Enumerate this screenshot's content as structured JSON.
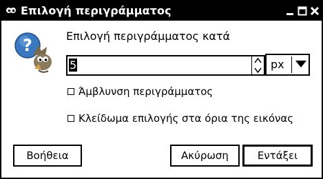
{
  "window": {
    "title": "Επιλογή περιγράμματος",
    "icons": {
      "app": "gimp-eye-icon",
      "minimize": "minimize-icon",
      "maximize": "maximize-icon",
      "close": "close-icon"
    }
  },
  "dialog": {
    "icon": "question-wilber-icon",
    "heading": "Επιλογή περιγράμματος κατά",
    "border_value": "5",
    "unit": "px",
    "options": [
      {
        "label": "Άμβλυνση περιγράμματος",
        "checked": false
      },
      {
        "label": "Κλείδωμα επιλογής στα όρια της εικόνας",
        "checked": false
      }
    ]
  },
  "buttons": {
    "help": "Βοήθεια",
    "cancel": "Ακύρωση",
    "ok": "Εντάξει"
  }
}
